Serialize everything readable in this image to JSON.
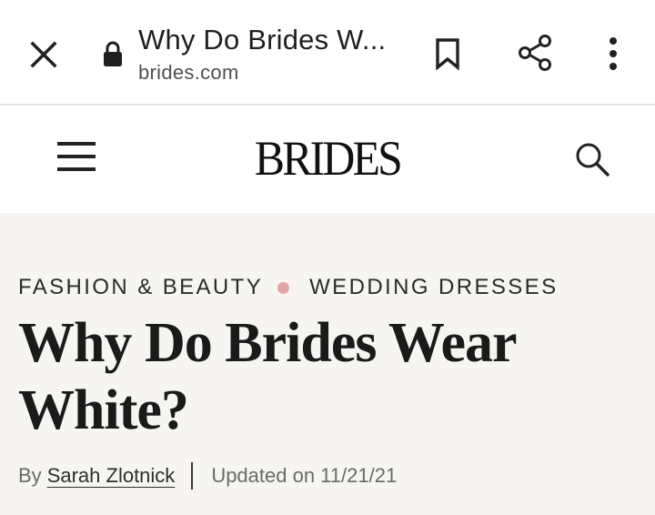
{
  "browser": {
    "tab_title": "Why Do Brides W...",
    "domain": "brides.com",
    "icons": {
      "close": "close-icon",
      "lock": "lock-icon",
      "bookmark": "bookmark-icon",
      "share": "share-icon",
      "more": "more-vert-icon"
    }
  },
  "site": {
    "logo": "BRIDES",
    "icons": {
      "menu": "hamburger-icon",
      "search": "search-icon"
    }
  },
  "article": {
    "breadcrumbs": [
      "FASHION & BEAUTY",
      "WEDDING DRESSES"
    ],
    "headline": "Why Do Brides Wear White?",
    "byline_prefix": "By",
    "author": "Sarah Zlotnick",
    "updated": "Updated on 11/21/21"
  },
  "colors": {
    "article_background": "#f6f5f1",
    "breadcrumb_dot": "#e3a6a6",
    "text": "#1a1a1a"
  }
}
